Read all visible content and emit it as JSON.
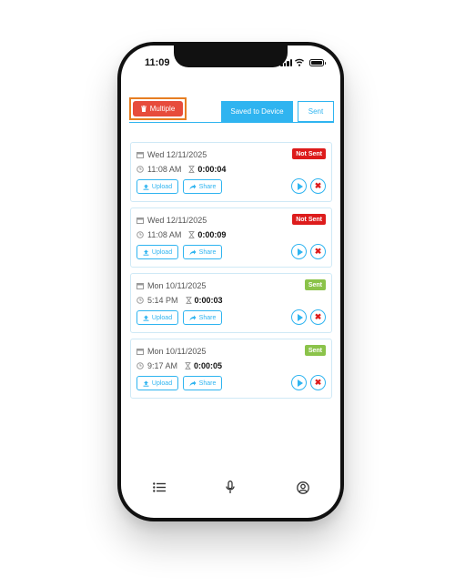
{
  "status_bar": {
    "time": "11:09"
  },
  "toolbar": {
    "multiple_label": "Multiple"
  },
  "tabs": [
    {
      "label": "Saved to Device",
      "active": true
    },
    {
      "label": "Sent",
      "active": false
    }
  ],
  "recordings": [
    {
      "date": "Wed 12/11/2025",
      "time": "11:08 AM",
      "duration": "0:00:04",
      "status": "Not Sent",
      "status_color": "#dd1c1c",
      "upload_label": "Upload",
      "share_label": "Share"
    },
    {
      "date": "Wed 12/11/2025",
      "time": "11:08 AM",
      "duration": "0:00:09",
      "status": "Not Sent",
      "status_color": "#dd1c1c",
      "upload_label": "Upload",
      "share_label": "Share"
    },
    {
      "date": "Mon 10/11/2025",
      "time": "5:14 PM",
      "duration": "0:00:03",
      "status": "Sent",
      "status_color": "#8bc34a",
      "upload_label": "Upload",
      "share_label": "Share"
    },
    {
      "date": "Mon 10/11/2025",
      "time": "9:17 AM",
      "duration": "0:00:05",
      "status": "Sent",
      "status_color": "#8bc34a",
      "upload_label": "Upload",
      "share_label": "Share"
    }
  ],
  "bottom_nav": [
    {
      "icon": "list-icon"
    },
    {
      "icon": "microphone-icon"
    },
    {
      "icon": "user-circle-icon"
    }
  ],
  "colors": {
    "accent": "#2fb4f0",
    "danger": "#e74c3c",
    "highlight_border": "#e67e22"
  }
}
